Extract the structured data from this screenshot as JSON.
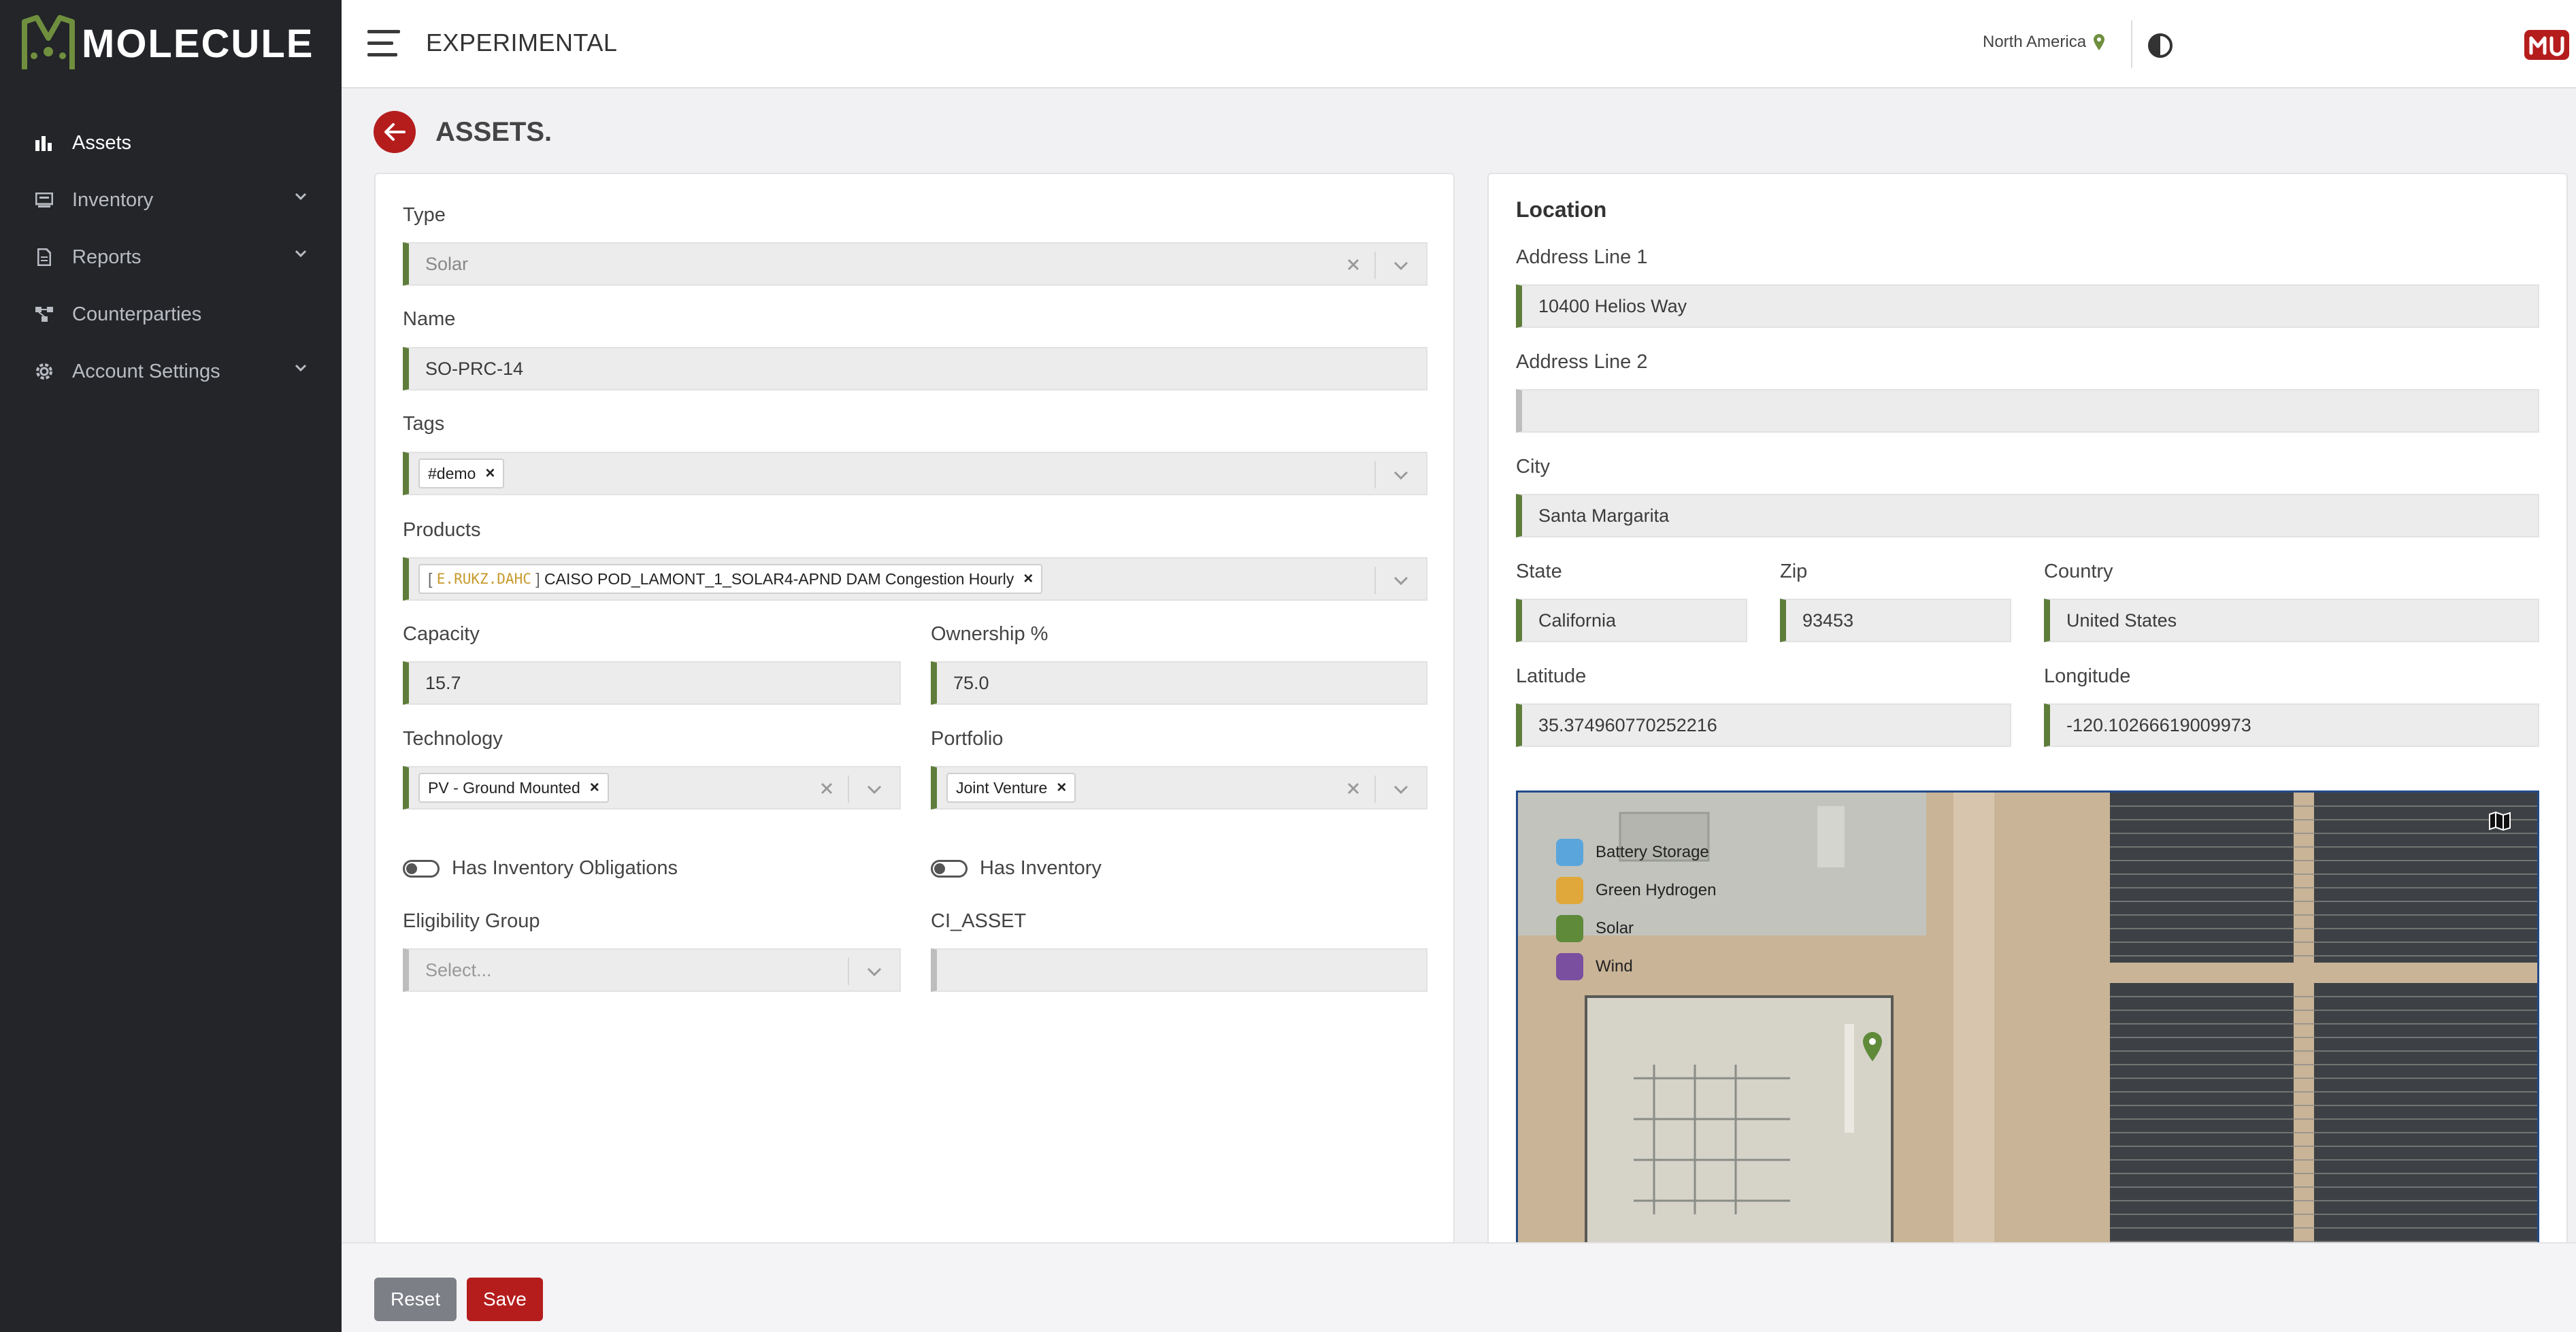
{
  "app": {
    "brand": "MOLECULE",
    "header_title": "EXPERIMENTAL",
    "region": "North America"
  },
  "sidebar": {
    "items": [
      {
        "label": "Assets",
        "icon": "chart-icon",
        "active": true
      },
      {
        "label": "Inventory",
        "icon": "inventory-icon",
        "expandable": true
      },
      {
        "label": "Reports",
        "icon": "report-icon",
        "expandable": true
      },
      {
        "label": "Counterparties",
        "icon": "network-icon"
      },
      {
        "label": "Account Settings",
        "icon": "gear-icon",
        "expandable": true
      }
    ]
  },
  "page": {
    "title": "ASSETS."
  },
  "form": {
    "type": {
      "label": "Type",
      "value": "Solar"
    },
    "name": {
      "label": "Name",
      "value": "SO-PRC-14"
    },
    "tags": {
      "label": "Tags",
      "chips": [
        "#demo"
      ]
    },
    "products": {
      "label": "Products",
      "code": "E.RUKZ.DAHC",
      "text": "CAISO POD_LAMONT_1_SOLAR4-APND DAM Congestion Hourly"
    },
    "capacity": {
      "label": "Capacity",
      "value": "15.7"
    },
    "ownership": {
      "label": "Ownership %",
      "value": "75.0"
    },
    "technology": {
      "label": "Technology",
      "chip": "PV - Ground Mounted"
    },
    "portfolio": {
      "label": "Portfolio",
      "chip": "Joint Venture"
    },
    "has_inventory_obligations": {
      "label": "Has Inventory Obligations",
      "on": false
    },
    "has_inventory": {
      "label": "Has Inventory",
      "on": false
    },
    "eligibility_group": {
      "label": "Eligibility Group",
      "placeholder": "Select..."
    },
    "ci_asset": {
      "label": "CI_ASSET",
      "value": ""
    }
  },
  "location": {
    "title": "Location",
    "address1": {
      "label": "Address Line 1",
      "value": "10400 Helios Way"
    },
    "address2": {
      "label": "Address Line 2",
      "value": ""
    },
    "city": {
      "label": "City",
      "value": "Santa Margarita"
    },
    "state": {
      "label": "State",
      "value": "California"
    },
    "zip": {
      "label": "Zip",
      "value": "93453"
    },
    "country": {
      "label": "Country",
      "value": "United States"
    },
    "latitude": {
      "label": "Latitude",
      "value": "35.374960770252216"
    },
    "longitude": {
      "label": "Longitude",
      "value": "-120.10266619009973"
    }
  },
  "map": {
    "legend": [
      {
        "label": "Battery Storage",
        "color": "#5aa6dc"
      },
      {
        "label": "Green Hydrogen",
        "color": "#e0a73a"
      },
      {
        "label": "Solar",
        "color": "#5e8a3a"
      },
      {
        "label": "Wind",
        "color": "#7a4fa0"
      }
    ]
  },
  "footer": {
    "reset_label": "Reset",
    "save_label": "Save"
  },
  "colors": {
    "accent": "#b51d1d",
    "field_border": "#5e7d3a",
    "sidebar_bg": "#232529"
  }
}
